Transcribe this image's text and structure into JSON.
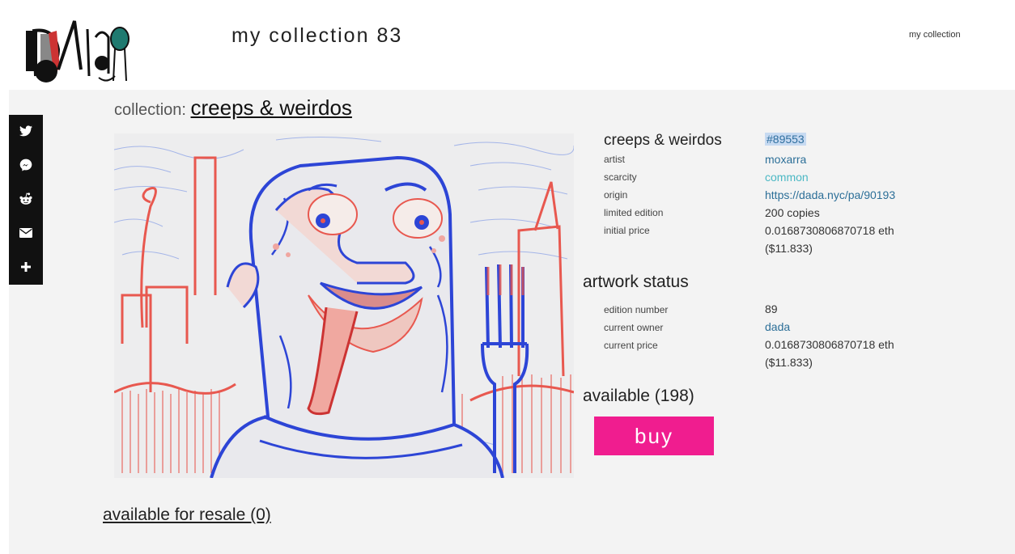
{
  "header": {
    "title": "my collection 83",
    "nav_link": "my collection"
  },
  "share": {
    "icons": [
      "twitter-icon",
      "messenger-icon",
      "reddit-icon",
      "email-icon",
      "plus-icon"
    ]
  },
  "collection": {
    "label": "collection:",
    "name": "creeps & weirdos"
  },
  "artwork": {
    "name": "creeps & weirdos",
    "id": "#89553",
    "details": [
      {
        "label": "artist",
        "value": "moxarra"
      },
      {
        "label": "scarcity",
        "value": "common"
      },
      {
        "label": "origin",
        "value": "https://dada.nyc/pa/90193"
      },
      {
        "label": "limited edition",
        "value": "200 copies"
      },
      {
        "label": "initial price",
        "value": "0.0168730806870718 eth",
        "value2": "($11.833)"
      }
    ]
  },
  "status": {
    "heading": "artwork status",
    "details": [
      {
        "label": "edition number",
        "value": "89"
      },
      {
        "label": "current owner",
        "value": "dada"
      },
      {
        "label": "current price",
        "value": "0.0168730806870718 eth",
        "value2": "($11.833)"
      }
    ]
  },
  "availability": {
    "text": "available (198)",
    "buy_label": "buy"
  },
  "resale": {
    "text": "available for resale (0)"
  },
  "colors": {
    "buy_button": "#f01d8f",
    "link": "#2c6f98",
    "scarcity": "#4bb8c4",
    "drawing_red": "#e8584f",
    "drawing_blue": "#2d45d6"
  }
}
